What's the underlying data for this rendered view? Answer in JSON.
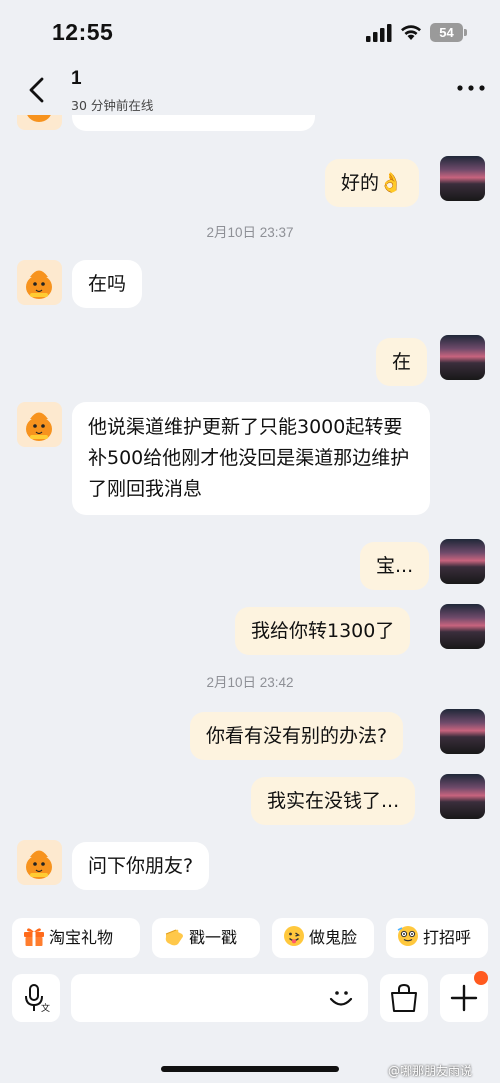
{
  "status_bar": {
    "time": "12:55",
    "battery": "54"
  },
  "header": {
    "contact_name": "1",
    "contact_status": "30 分钟前在线"
  },
  "messages": [
    {
      "from": "me",
      "text": "好的👌"
    },
    {
      "timestamp": "2月10日 23:37"
    },
    {
      "from": "other",
      "text": "在吗"
    },
    {
      "from": "me",
      "text": "在"
    },
    {
      "from": "other",
      "text": "他说渠道维护更新了只能3000起转要补500给他刚才他没回是渠道那边维护了刚回我消息"
    },
    {
      "from": "me",
      "text": "宝..."
    },
    {
      "from": "me",
      "text": "我给你转1300了"
    },
    {
      "timestamp": "2月10日 23:42"
    },
    {
      "from": "me",
      "text": "你看有没有别的办法?"
    },
    {
      "from": "me",
      "text": "我实在没钱了..."
    },
    {
      "from": "other",
      "text": "问下你朋友?"
    }
  ],
  "quick_actions": [
    {
      "label": "淘宝礼物",
      "icon": "gift-icon"
    },
    {
      "label": "戳一戳",
      "icon": "poke-hand-icon"
    },
    {
      "label": "做鬼脸",
      "icon": "silly-face-icon"
    },
    {
      "label": "打招呼",
      "icon": "greeting-face-icon"
    }
  ],
  "input": {
    "placeholder": ""
  },
  "watermark": "@哪那朋友雨说",
  "colors": {
    "background": "#eef0f4",
    "my_bubble": "#fdf3df",
    "other_bubble": "#ffffff",
    "accent_dot": "#ff5a1f"
  }
}
